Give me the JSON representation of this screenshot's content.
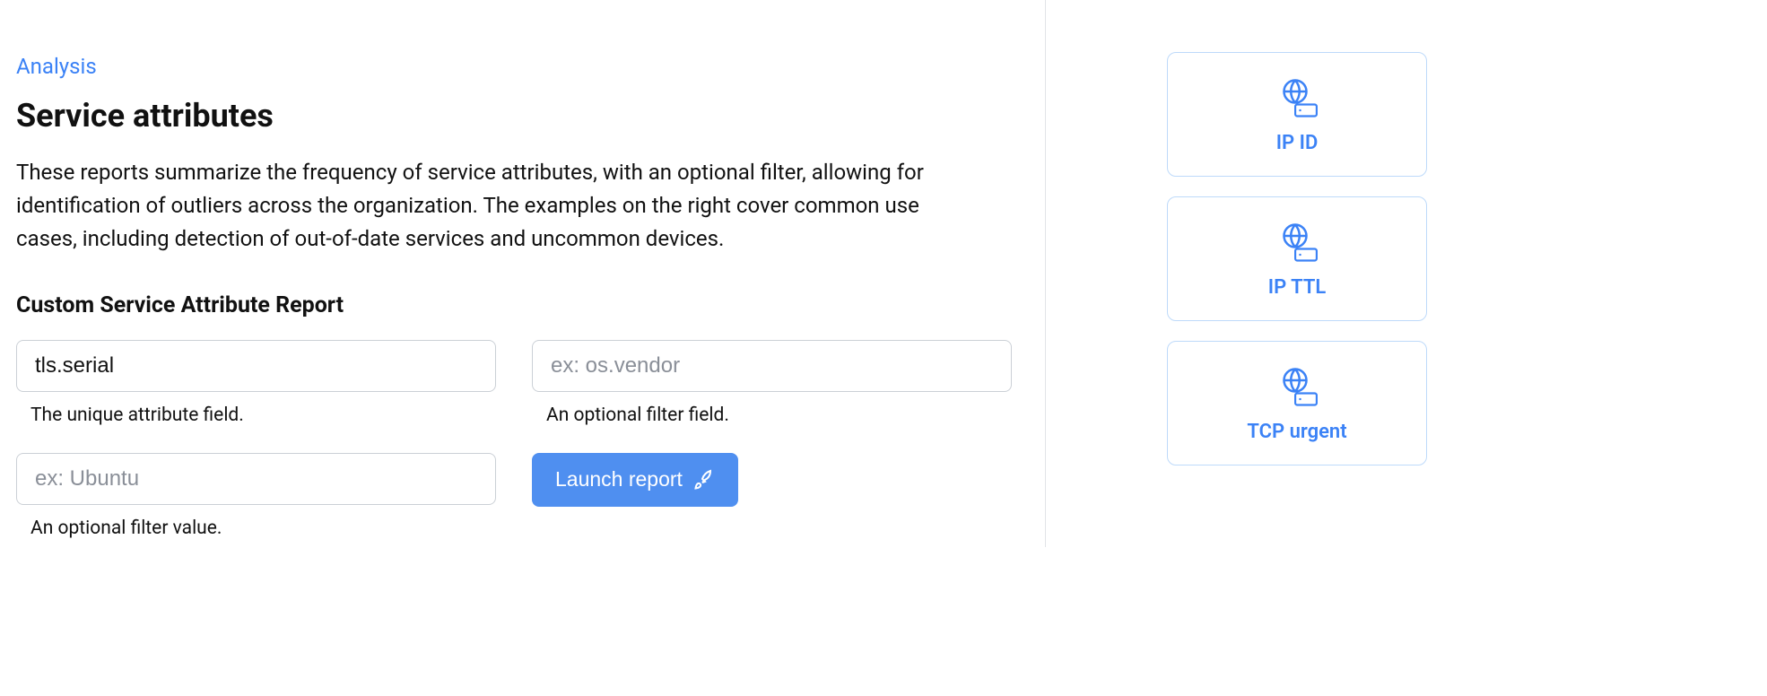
{
  "breadcrumb": "Analysis",
  "page_title": "Service attributes",
  "description": "These reports summarize the frequency of service attributes, with an optional filter, allowing for identification of outliers across the organization. The examples on the right cover common use cases, including detection of out-of-date services and uncommon devices.",
  "section_title": "Custom Service Attribute Report",
  "form": {
    "attribute_field": {
      "value": "tls.serial",
      "help": "The unique attribute field."
    },
    "filter_field": {
      "placeholder": "ex: os.vendor",
      "help": "An optional filter field."
    },
    "filter_value": {
      "placeholder": "ex: Ubuntu",
      "help": "An optional filter value."
    },
    "submit_label": "Launch report"
  },
  "cards": [
    {
      "label": "IP ID"
    },
    {
      "label": "IP TTL"
    },
    {
      "label": "TCP urgent"
    }
  ]
}
